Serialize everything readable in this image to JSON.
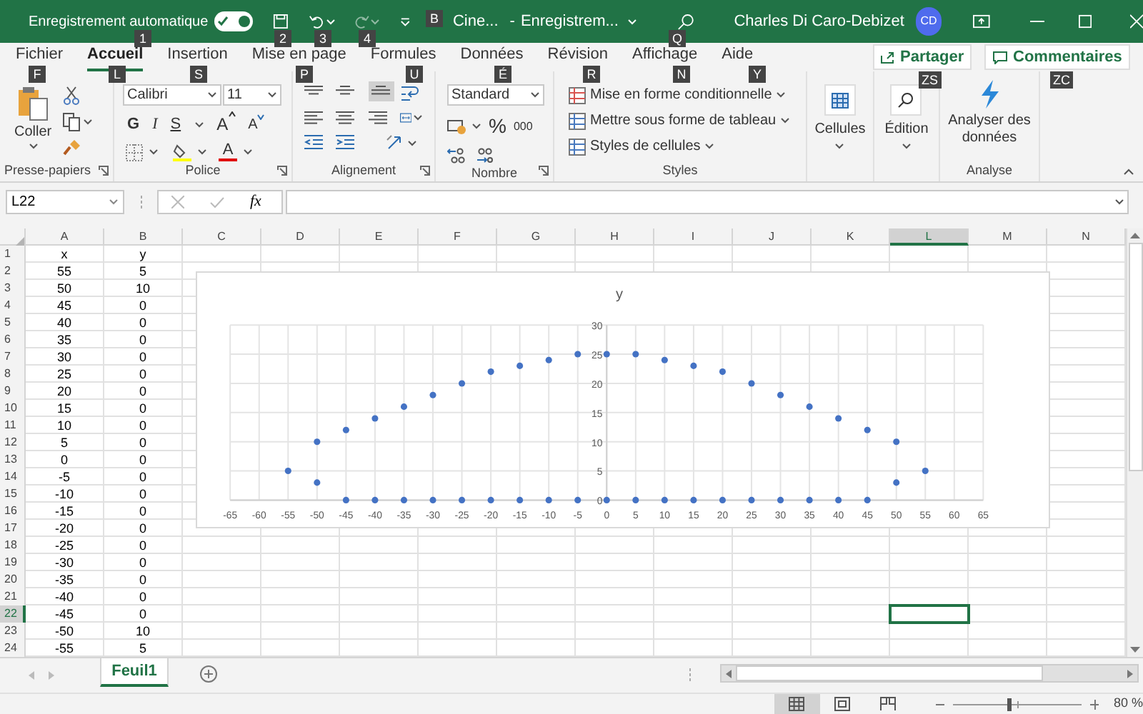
{
  "title_bar": {
    "autosave_label": "Enregistrement automatique",
    "autosave_on": true,
    "document": "Cine...",
    "separator": "-",
    "filename": "Enregistrem...",
    "user": "Charles Di Caro-Debizet",
    "avatar": "CD"
  },
  "tabs": [
    {
      "label": "Fichier",
      "selected": false
    },
    {
      "label": "Accueil",
      "selected": true
    },
    {
      "label": "Insertion",
      "selected": false
    },
    {
      "label": "Mise en page",
      "selected": false
    },
    {
      "label": "Formules",
      "selected": false
    },
    {
      "label": "Données",
      "selected": false
    },
    {
      "label": "Révision",
      "selected": false
    },
    {
      "label": "Affichage",
      "selected": false
    },
    {
      "label": "Aide",
      "selected": false
    }
  ],
  "share_button": "Partager",
  "comments_button": "Commentaires",
  "ribbon": {
    "clipboard": {
      "paste": "Coller",
      "label": "Presse-papiers"
    },
    "font": {
      "name": "Calibri",
      "size": "11",
      "bold": "G",
      "italic": "I",
      "underline": "S",
      "grow": "A",
      "shrink": "A",
      "font_color_letter": "A",
      "label": "Police"
    },
    "alignment": {
      "label": "Alignement"
    },
    "number": {
      "format": "Standard",
      "percent": "%",
      "thousands": "000",
      "label": "Nombre"
    },
    "styles": {
      "items": [
        "Mise en forme conditionnelle",
        "Mettre sous forme de tableau",
        "Styles de cellules"
      ],
      "label": "Styles"
    },
    "cells": {
      "label": "Cellules"
    },
    "editing": {
      "label": "Édition"
    },
    "analysis": {
      "button": "Analyser des données",
      "label": "Analyse"
    }
  },
  "keytips": [
    "1",
    "2",
    "3",
    "4",
    "B",
    "Q",
    "F",
    "L",
    "S",
    "P",
    "U",
    "É",
    "R",
    "N",
    "Y",
    "ZS",
    "ZC"
  ],
  "formula_bar": {
    "name_box": "L22",
    "fx": "fx"
  },
  "columns": [
    {
      "label": "A",
      "selected": false
    },
    {
      "label": "B",
      "selected": false
    },
    {
      "label": "C",
      "selected": false
    },
    {
      "label": "D",
      "selected": false
    },
    {
      "label": "E",
      "selected": false
    },
    {
      "label": "F",
      "selected": false
    },
    {
      "label": "G",
      "selected": false
    },
    {
      "label": "H",
      "selected": false
    },
    {
      "label": "I",
      "selected": false
    },
    {
      "label": "J",
      "selected": false
    },
    {
      "label": "K",
      "selected": false
    },
    {
      "label": "L",
      "selected": true
    },
    {
      "label": "M",
      "selected": false
    },
    {
      "label": "N",
      "selected": false
    }
  ],
  "rows": [
    {
      "header": "1",
      "selected": false,
      "cells": [
        "x",
        "y"
      ]
    },
    {
      "header": "2",
      "selected": false,
      "cells": [
        "55",
        "5"
      ]
    },
    {
      "header": "3",
      "selected": false,
      "cells": [
        "50",
        "10"
      ]
    },
    {
      "header": "4",
      "selected": false,
      "cells": [
        "45",
        "0"
      ]
    },
    {
      "header": "5",
      "selected": false,
      "cells": [
        "40",
        "0"
      ]
    },
    {
      "header": "6",
      "selected": false,
      "cells": [
        "35",
        "0"
      ]
    },
    {
      "header": "7",
      "selected": false,
      "cells": [
        "30",
        "0"
      ]
    },
    {
      "header": "8",
      "selected": false,
      "cells": [
        "25",
        "0"
      ]
    },
    {
      "header": "9",
      "selected": false,
      "cells": [
        "20",
        "0"
      ]
    },
    {
      "header": "10",
      "selected": false,
      "cells": [
        "15",
        "0"
      ]
    },
    {
      "header": "11",
      "selected": false,
      "cells": [
        "10",
        "0"
      ]
    },
    {
      "header": "12",
      "selected": false,
      "cells": [
        "5",
        "0"
      ]
    },
    {
      "header": "13",
      "selected": false,
      "cells": [
        "0",
        "0"
      ]
    },
    {
      "header": "14",
      "selected": false,
      "cells": [
        "-5",
        "0"
      ]
    },
    {
      "header": "15",
      "selected": false,
      "cells": [
        "-10",
        "0"
      ]
    },
    {
      "header": "16",
      "selected": false,
      "cells": [
        "-15",
        "0"
      ]
    },
    {
      "header": "17",
      "selected": false,
      "cells": [
        "-20",
        "0"
      ]
    },
    {
      "header": "18",
      "selected": false,
      "cells": [
        "-25",
        "0"
      ]
    },
    {
      "header": "19",
      "selected": false,
      "cells": [
        "-30",
        "0"
      ]
    },
    {
      "header": "20",
      "selected": false,
      "cells": [
        "-35",
        "0"
      ]
    },
    {
      "header": "21",
      "selected": false,
      "cells": [
        "-40",
        "0"
      ]
    },
    {
      "header": "22",
      "selected": true,
      "cells": [
        "-45",
        "0"
      ]
    },
    {
      "header": "23",
      "selected": false,
      "cells": [
        "-50",
        "10"
      ]
    },
    {
      "header": "24",
      "selected": false,
      "cells": [
        "-55",
        "5"
      ]
    }
  ],
  "chart": {
    "chart_data": {
      "type": "scatter",
      "grid": true,
      "x": [
        -55,
        -50,
        -50,
        -45,
        -40,
        -35,
        -30,
        -25,
        -20,
        -15,
        -10,
        -5,
        0,
        5,
        10,
        15,
        20,
        25,
        30,
        35,
        40,
        45,
        50,
        50,
        55,
        -45,
        -40,
        -35,
        -30,
        -25,
        -20,
        -15,
        -10,
        -5,
        0,
        5,
        10,
        15,
        20,
        25,
        30,
        35,
        40,
        45
      ],
      "series": [
        {
          "name": "y",
          "color": "#4472c4",
          "values": [
            5,
            10,
            3,
            12,
            14,
            16,
            18,
            20,
            22,
            23,
            24,
            25,
            25,
            25,
            24,
            23,
            22,
            20,
            18,
            16,
            14,
            12,
            10,
            3,
            5,
            0,
            0,
            0,
            0,
            0,
            0,
            0,
            0,
            0,
            0,
            0,
            0,
            0,
            0,
            0,
            0,
            0,
            0,
            0
          ]
        }
      ],
      "xlim": [
        -65,
        65
      ],
      "ylim": [
        0,
        30
      ],
      "xticks": [
        -65,
        -60,
        -55,
        -50,
        -45,
        -40,
        -35,
        -30,
        -25,
        -20,
        -15,
        -10,
        -5,
        0,
        5,
        10,
        15,
        20,
        25,
        30,
        35,
        40,
        45,
        50,
        55,
        60,
        65
      ],
      "yticks": [
        0,
        5,
        10,
        15,
        20,
        25,
        30
      ]
    }
  },
  "sheet_tabs": [
    {
      "label": "Feuil1",
      "selected": true
    }
  ],
  "status_bar": {
    "view_buttons": [
      {
        "kind": "normal",
        "selected": true
      },
      {
        "kind": "page_layout",
        "selected": false
      },
      {
        "kind": "page_break",
        "selected": false
      }
    ],
    "zoom": {
      "level": 0.44
    },
    "zoom_label": "80 %"
  }
}
